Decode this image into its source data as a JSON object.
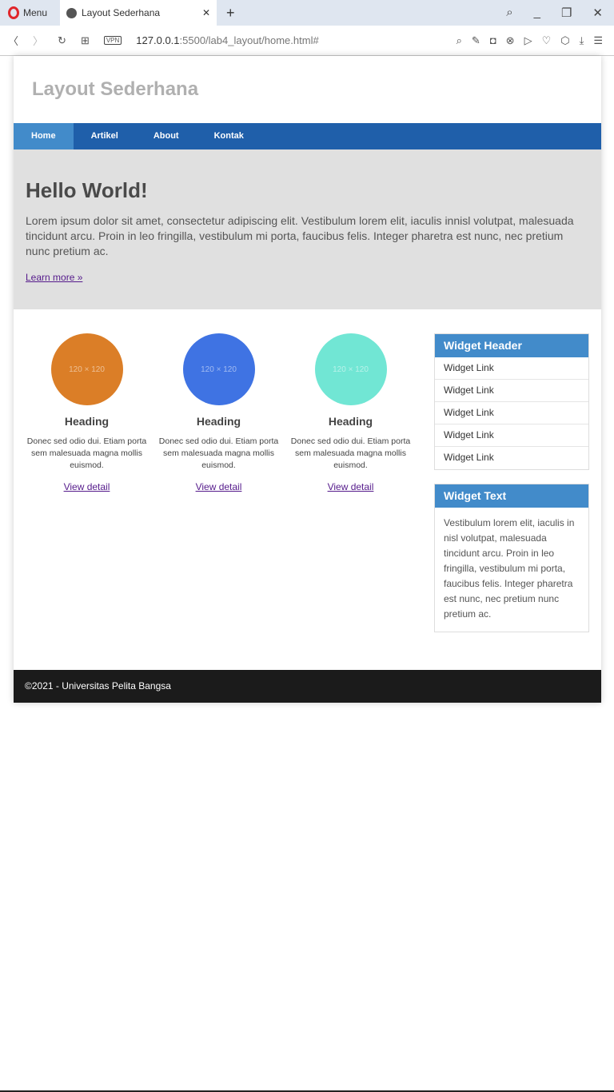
{
  "browser": {
    "menu_label": "Menu",
    "tab_title": "Layout Sederhana",
    "url_host": "127.0.0.1",
    "url_rest": ":5500/lab4_layout/home.html#",
    "vpn": "VPN"
  },
  "site": {
    "title": "Layout Sederhana",
    "nav": [
      {
        "label": "Home"
      },
      {
        "label": "Artikel"
      },
      {
        "label": "About"
      },
      {
        "label": "Kontak"
      }
    ],
    "hero": {
      "title": "Hello World!",
      "text": "Lorem ipsum dolor sit amet, consectetur adipiscing elit. Vestibulum lorem elit, iaculis innisl volutpat, malesuada tincidunt arcu. Proin in leo fringilla, vestibulum mi porta, faucibus felis. Integer pharetra est nunc, nec pretium nunc pretium ac.",
      "link": "Learn more »"
    },
    "cards": [
      {
        "img": "120 × 120",
        "color": "#db7e27",
        "heading": "Heading",
        "text": "Donec sed odio dui. Etiam porta sem malesuada magna mollis euismod.",
        "link": "View detail"
      },
      {
        "img": "120 × 120",
        "color": "#3f73e3",
        "heading": "Heading",
        "text": "Donec sed odio dui. Etiam porta sem malesuada magna mollis euismod.",
        "link": "View detail"
      },
      {
        "img": "120 × 120",
        "color": "#71e6d4",
        "heading": "Heading",
        "text": "Donec sed odio dui. Etiam porta sem malesuada magna mollis euismod.",
        "link": "View detail"
      }
    ],
    "widget1": {
      "header": "Widget Header",
      "links": [
        "Widget Link",
        "Widget Link",
        "Widget Link",
        "Widget Link",
        "Widget Link"
      ]
    },
    "widget2": {
      "header": "Widget Text",
      "text": "Vestibulum lorem elit, iaculis in nisl volutpat, malesuada tincidunt arcu. Proin in leo fringilla, vestibulum mi porta, faucibus felis. Integer pharetra est nunc, nec pretium nunc pretium ac."
    },
    "footer": "©2021 - Universitas Pelita Bangsa"
  }
}
